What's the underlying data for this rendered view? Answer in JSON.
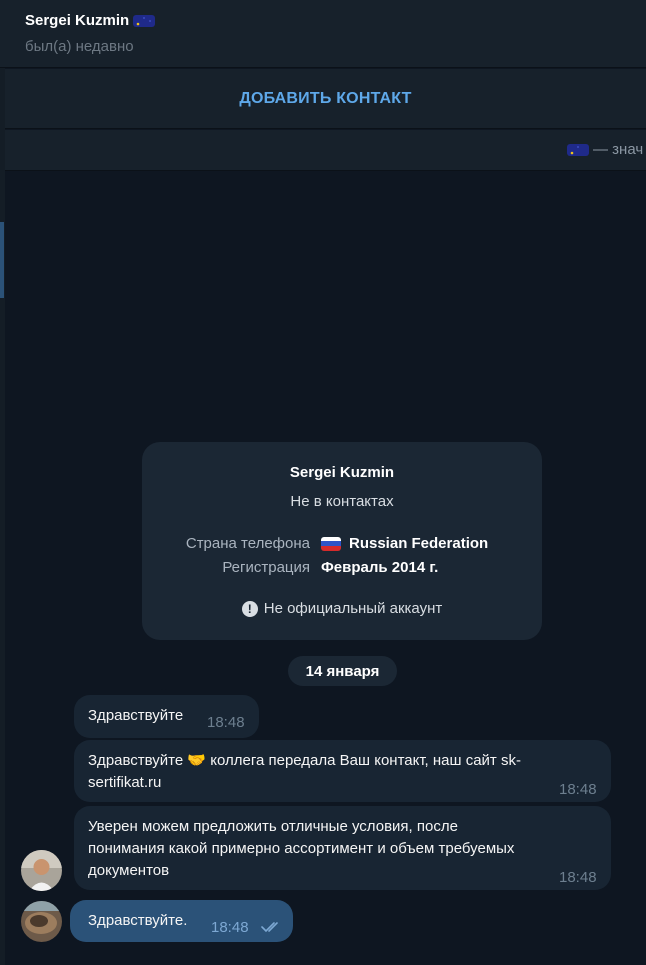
{
  "header": {
    "name": "Sergei Kuzmin",
    "status": "был(а) недавно"
  },
  "add_contact": {
    "label": "ДОБАВИТЬ КОНТАКТ"
  },
  "notice": {
    "text": "— знач"
  },
  "info_card": {
    "name": "Sergei Kuzmin",
    "subtitle": "Не в контактах",
    "phone_country_label": "Страна телефона",
    "phone_country_value": "Russian Federation",
    "registration_label": "Регистрация",
    "registration_value": "Февраль 2014 г.",
    "official_note": "Не официальный аккаунт"
  },
  "date_separator": "14 января",
  "messages": [
    {
      "direction": "in",
      "text": "Здравствуйте",
      "time": "18:48"
    },
    {
      "direction": "in",
      "text_line1": "Здравствуйте 🤝 коллега передала Ваш контакт, наш сайт sk-",
      "text_line2": "sertifikat.ru",
      "time": "18:48"
    },
    {
      "direction": "in",
      "text_line1": "Уверен можем предложить отличные условия, после",
      "text_line2": "понимания какой примерно ассортимент и объем требуемых",
      "text_line3": "документов",
      "time": "18:48"
    },
    {
      "direction": "out",
      "text": "Здравствуйте.",
      "time": "18:48",
      "read": true
    }
  ],
  "colors": {
    "background": "#0e1621",
    "panel": "#17212b",
    "incoming_bubble": "#182533",
    "outgoing_bubble": "#2b5278",
    "accent": "#5ea8e9"
  },
  "icons": {
    "premium_emoji": "eu-flag-premium-emoji",
    "flag": "russia-flag-icon",
    "info": "exclamation-circle-icon",
    "read_receipt": "double-check-icon"
  }
}
